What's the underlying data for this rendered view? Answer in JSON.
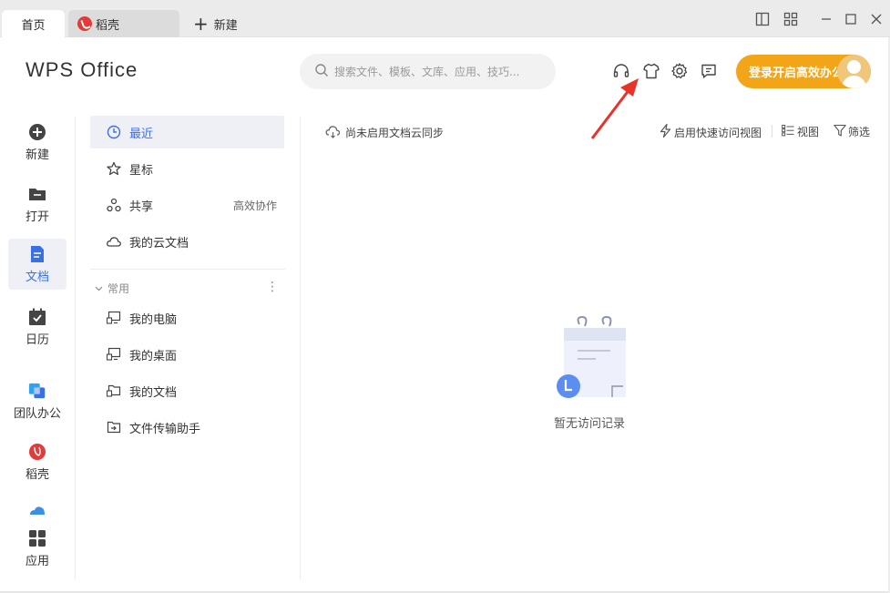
{
  "tabs": {
    "home": "首页",
    "daoke": "稻壳",
    "new": "新建"
  },
  "header": {
    "logo": "WPS Office",
    "search_placeholder": "搜索文件、模板、文库、应用、技巧...",
    "login_label": "登录开启高效办公"
  },
  "rail": {
    "new": "新建",
    "open": "打开",
    "docs": "文档",
    "calendar": "日历",
    "team": "团队办公",
    "daoke": "稻壳",
    "apps": "应用"
  },
  "nav": {
    "recent": "最近",
    "starred": "星标",
    "shared": "共享",
    "shared_extra": "高效协作",
    "cloud": "我的云文档",
    "section": "常用",
    "computer": "我的电脑",
    "desktop": "我的桌面",
    "documents": "我的文档",
    "transfer": "文件传输助手"
  },
  "main": {
    "cloud_sync": "尚未启用文档云同步",
    "quick_access": "启用快速访问视图",
    "view": "视图",
    "filter": "筛选",
    "empty": "暂无访问记录"
  },
  "colors": {
    "accent": "#3b6fe5",
    "login_bg": "#f2a517",
    "arrow": "#e8332a"
  }
}
